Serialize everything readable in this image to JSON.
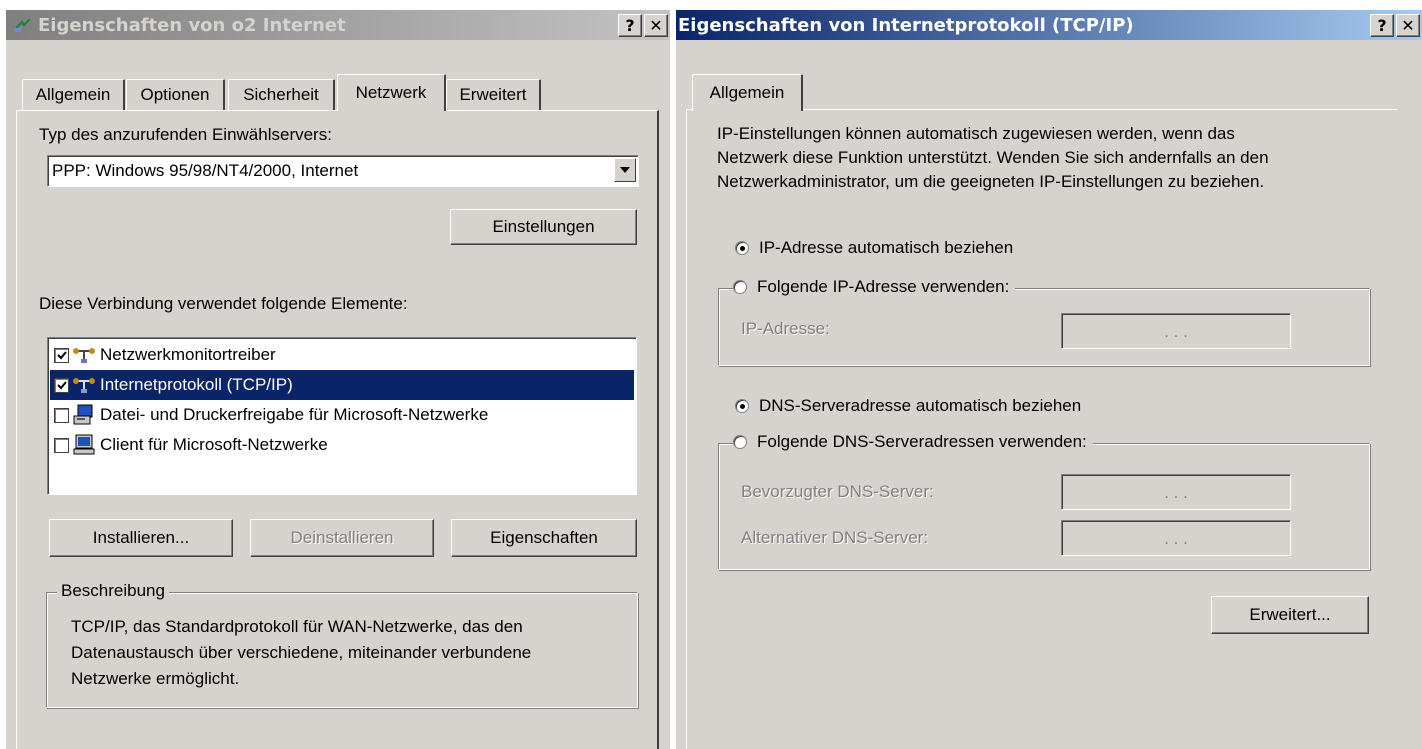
{
  "left_window": {
    "title": "Eigenschaften von o2 Internet",
    "help_button": "?",
    "close_button": "✕",
    "tabs": [
      "Allgemein",
      "Optionen",
      "Sicherheit",
      "Netzwerk",
      "Erweitert"
    ],
    "selected_tab": "Netzwerk",
    "server_type_label": "Typ des anzurufenden Einwählservers:",
    "server_type_value": "PPP: Windows 95/98/NT4/2000, Internet",
    "settings_button": "Einstellungen",
    "components_label": "Diese Verbindung verwendet folgende Elemente:",
    "components": [
      {
        "label": "Netzwerkmonitortreiber",
        "checked": true,
        "selected": false,
        "icon": "network-protocol-icon"
      },
      {
        "label": "Internetprotokoll (TCP/IP)",
        "checked": true,
        "selected": true,
        "icon": "network-protocol-icon"
      },
      {
        "label": "Datei- und Druckerfreigabe für Microsoft-Netzwerke",
        "checked": false,
        "selected": false,
        "icon": "file-printer-sharing-icon"
      },
      {
        "label": "Client für Microsoft-Netzwerke",
        "checked": false,
        "selected": false,
        "icon": "network-client-icon"
      }
    ],
    "install_button": "Installieren...",
    "uninstall_button": "Deinstallieren",
    "properties_button": "Eigenschaften",
    "description_title": "Beschreibung",
    "description_text": [
      "TCP/IP, das Standardprotokoll für WAN-Netzwerke, das den",
      "Datenaustausch über verschiedene, miteinander verbundene",
      "Netzwerke ermöglicht."
    ]
  },
  "right_window": {
    "title": "Eigenschaften von Internetprotokoll (TCP/IP)",
    "help_button": "?",
    "close_button": "✕",
    "tabs": [
      "Allgemein"
    ],
    "intro_text": [
      "IP-Einstellungen können automatisch zugewiesen werden, wenn das",
      "Netzwerk diese Funktion unterstützt. Wenden Sie sich andernfalls an den",
      "Netzwerkadministrator, um die geeigneten IP-Einstellungen zu beziehen."
    ],
    "ip_auto_label": "IP-Adresse automatisch beziehen",
    "ip_manual_label": "Folgende IP-Adresse verwenden:",
    "ip_address_label": "IP-Adresse:",
    "ip_address_value": ". . .",
    "dns_auto_label": "DNS-Serveradresse automatisch beziehen",
    "dns_manual_label": "Folgende DNS-Serveradressen verwenden:",
    "preferred_dns_label": "Bevorzugter DNS-Server:",
    "alternate_dns_label": "Alternativer DNS-Server:",
    "ip_selected": "auto",
    "dns_selected": "auto",
    "advanced_button": "Erweitert..."
  },
  "colors": {
    "dialog_face": "#d6d3ce",
    "active_title": "#0a246a",
    "inactive_title": "#7f7f7f",
    "selection": "#0a246a"
  }
}
